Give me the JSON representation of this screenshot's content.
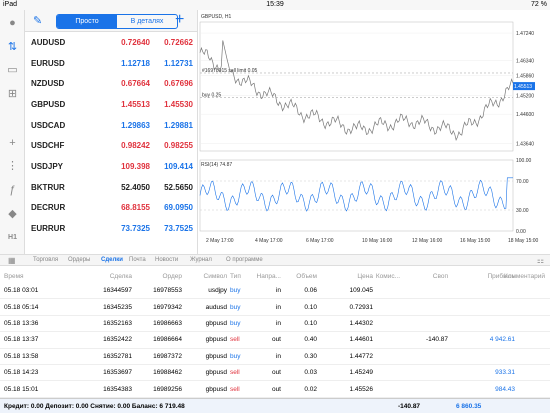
{
  "status": {
    "device": "iPad",
    "time": "15:39",
    "battery": "72 %"
  },
  "toolbar": {
    "simple": "Просто",
    "detailed": "В деталях"
  },
  "quotes": [
    {
      "symbol": "AUDUSD",
      "bid": "0.72640",
      "ask": "0.72662",
      "bid_color": "red",
      "ask_color": "red"
    },
    {
      "symbol": "EURUSD",
      "bid": "1.12718",
      "ask": "1.12731",
      "bid_color": "blue",
      "ask_color": "blue"
    },
    {
      "symbol": "NZDUSD",
      "bid": "0.67664",
      "ask": "0.67696",
      "bid_color": "red",
      "ask_color": "red"
    },
    {
      "symbol": "GBPUSD",
      "bid": "1.45513",
      "ask": "1.45530",
      "bid_color": "red",
      "ask_color": "red"
    },
    {
      "symbol": "USDCAD",
      "bid": "1.29863",
      "ask": "1.29881",
      "bid_color": "blue",
      "ask_color": "blue"
    },
    {
      "symbol": "USDCHF",
      "bid": "0.98242",
      "ask": "0.98255",
      "bid_color": "red",
      "ask_color": "red"
    },
    {
      "symbol": "USDJPY",
      "bid": "109.398",
      "ask": "109.414",
      "bid_color": "red",
      "ask_color": "blue"
    },
    {
      "symbol": "BKTRUR",
      "bid": "52.4050",
      "ask": "52.5650",
      "bid_color": "blk",
      "ask_color": "blk"
    },
    {
      "symbol": "DECRUR",
      "bid": "68.8155",
      "ask": "69.0950",
      "bid_color": "red",
      "ask_color": "blue"
    },
    {
      "symbol": "EURRUR",
      "bid": "73.7325",
      "ask": "73.7525",
      "bid_color": "blue",
      "ask_color": "blue"
    }
  ],
  "chart": {
    "title": "GBPUSD, H1",
    "sell_label": "#16978015 sell limit 0.05",
    "buy_label": "buy 0.25",
    "price_ticks": [
      "1.47240",
      "1.46340",
      "1.45860",
      "1.45200",
      "1.44600",
      "1.43640"
    ],
    "current_price": "1.45513",
    "rsi_label": "RSI(14) 74.87",
    "rsi_ticks": [
      "100.00",
      "70.00",
      "30.00",
      "0.00"
    ],
    "time_ticks": [
      "2 May 17:00",
      "4 May 17:00",
      "6 May 17:00",
      "10 May 16:00",
      "12 May 16:00",
      "16 May 15:00",
      "18 May 15:00"
    ]
  },
  "chart_data": {
    "type": "line",
    "title": "GBPUSD, H1",
    "x": [
      "2 May 17:00",
      "4 May 17:00",
      "6 May 17:00",
      "10 May 16:00",
      "12 May 16:00",
      "16 May 15:00",
      "18 May 15:00"
    ],
    "series": [
      {
        "name": "GBPUSD",
        "values": [
          1.466,
          1.455,
          1.446,
          1.441,
          1.444,
          1.44,
          1.455
        ]
      }
    ],
    "ylim": [
      1.434,
      1.476
    ]
  },
  "tabs": [
    "Торговля",
    "Ордеры",
    "Сделки",
    "Почта",
    "Новости",
    "Журнал",
    "О программе"
  ],
  "active_tab": "Сделки",
  "table": {
    "headers": [
      "Время",
      "Сделка",
      "Ордер",
      "Символ",
      "Тип",
      "Напра...",
      "Объем",
      "Цена",
      "Комис...",
      "Своп",
      "Прибыль",
      "Комментарий"
    ],
    "rows": [
      [
        "05.18 03:01",
        "16344597",
        "16978553",
        "usdjpy",
        "buy",
        "in",
        "0.06",
        "109.045",
        "",
        "",
        "",
        ""
      ],
      [
        "05.18 05:14",
        "16345235",
        "16979342",
        "audusd",
        "buy",
        "in",
        "0.10",
        "0.72931",
        "",
        "",
        "",
        ""
      ],
      [
        "05.18 13:36",
        "16352163",
        "16986663",
        "gbpusd",
        "buy",
        "in",
        "0.10",
        "1.44302",
        "",
        "",
        "",
        ""
      ],
      [
        "05.18 13:37",
        "16352422",
        "16986664",
        "gbpusd",
        "sell",
        "out",
        "0.40",
        "1.44601",
        "",
        "-140.87",
        "4 942.61",
        ""
      ],
      [
        "05.18 13:58",
        "16352781",
        "16987372",
        "gbpusd",
        "buy",
        "in",
        "0.30",
        "1.44772",
        "",
        "",
        "",
        ""
      ],
      [
        "05.18 14:23",
        "16353697",
        "16988462",
        "gbpusd",
        "sell",
        "out",
        "0.03",
        "1.45249",
        "",
        "",
        "933.31",
        ""
      ],
      [
        "05.18 15:01",
        "16354383",
        "16989256",
        "gbpusd",
        "sell",
        "out",
        "0.02",
        "1.45526",
        "",
        "",
        "984.43",
        ""
      ]
    ]
  },
  "footer": {
    "summary": "Кредит: 0.00 Депозит: 0.00 Снятие: 0.00 Баланс: 6 719.48",
    "swap": "-140.87",
    "profit": "6 860.35"
  },
  "colors": {
    "accent": "#1a73e8",
    "sell": "#e0323d",
    "buy": "#1a73e8"
  }
}
